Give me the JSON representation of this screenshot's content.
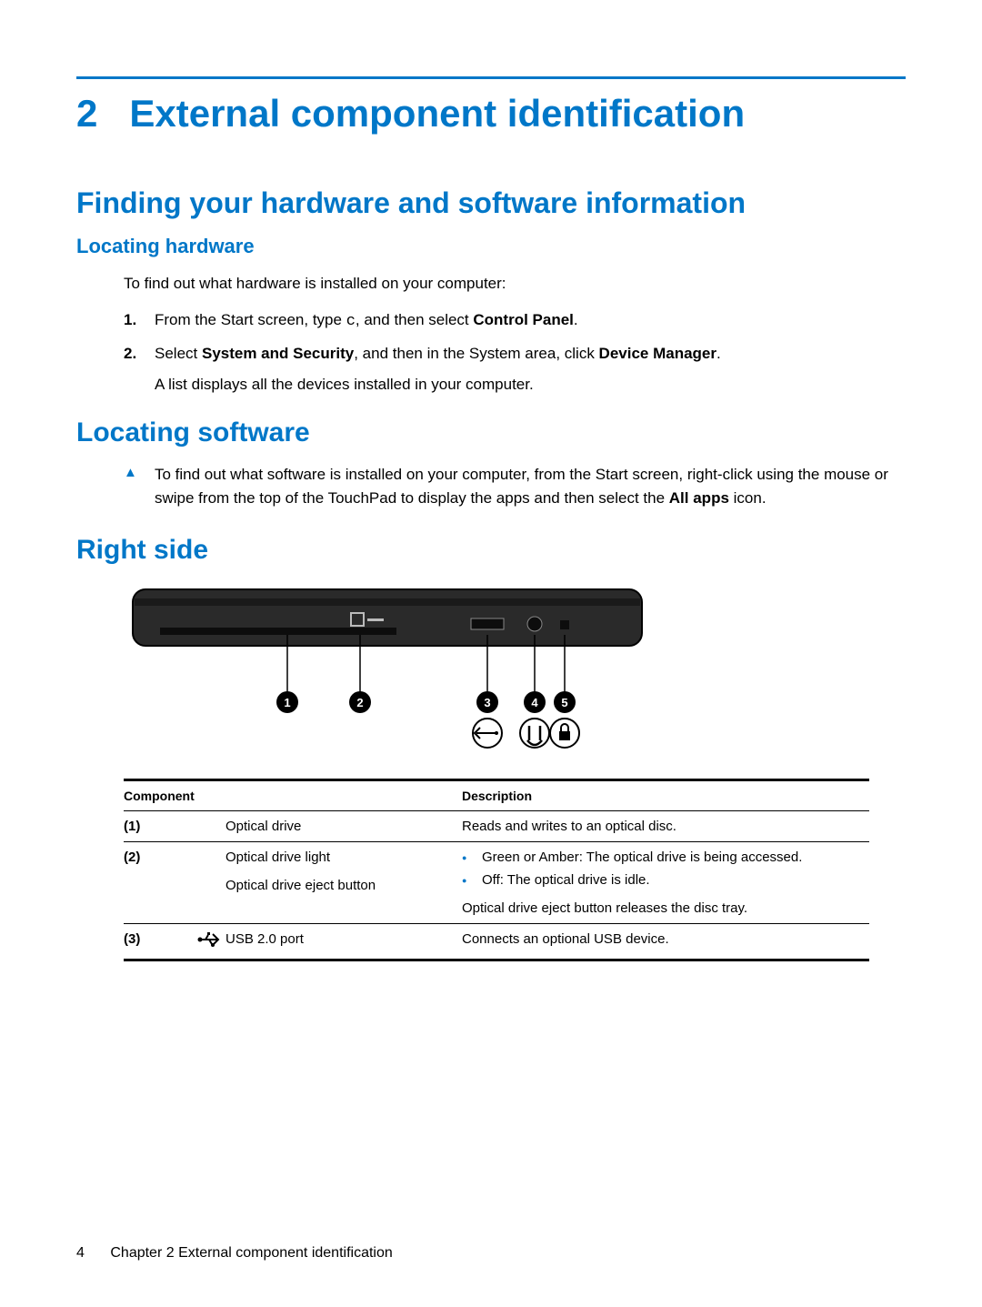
{
  "chapter": {
    "number": "2",
    "title": "External component identification"
  },
  "s1": {
    "heading": "Finding your hardware and software information",
    "sub": {
      "heading": "Locating hardware",
      "intro": "To find out what hardware is installed on your computer:",
      "step1_a": "From the Start screen, type ",
      "step1_code": "c",
      "step1_b": ", and then select ",
      "step1_bold": "Control Panel",
      "step1_c": ".",
      "step2_a": "Select ",
      "step2_bold1": "System and Security",
      "step2_b": ", and then in the System area, click ",
      "step2_bold2": "Device Manager",
      "step2_c": ".",
      "step2_after": "A list displays all the devices installed in your computer."
    }
  },
  "s2": {
    "heading": "Locating software",
    "para_a": "To find out what software is installed on your computer, from the Start screen, right-click using the mouse or swipe from the top of the TouchPad to display the apps and then select the ",
    "para_bold": "All apps",
    "para_b": " icon."
  },
  "s3": {
    "heading": "Right side",
    "callouts": [
      "1",
      "2",
      "3",
      "4",
      "5"
    ],
    "table": {
      "headers": {
        "component": "Component",
        "description": "Description"
      },
      "rows": [
        {
          "num": "(1)",
          "icon": "",
          "name": "Optical drive",
          "desc": "Reads and writes to an optical disc."
        },
        {
          "num": "(2)",
          "icon": "",
          "name": "Optical drive light",
          "bullets": [
            "Green or Amber: The optical drive is being accessed.",
            "Off: The optical drive is idle."
          ],
          "name2": "Optical drive eject button",
          "desc2": "Optical drive eject button releases the disc tray."
        },
        {
          "num": "(3)",
          "icon": "usb",
          "name": "USB 2.0 port",
          "desc": "Connects an optional USB device."
        }
      ]
    }
  },
  "footer": {
    "page": "4",
    "text": "Chapter 2   External component identification"
  }
}
